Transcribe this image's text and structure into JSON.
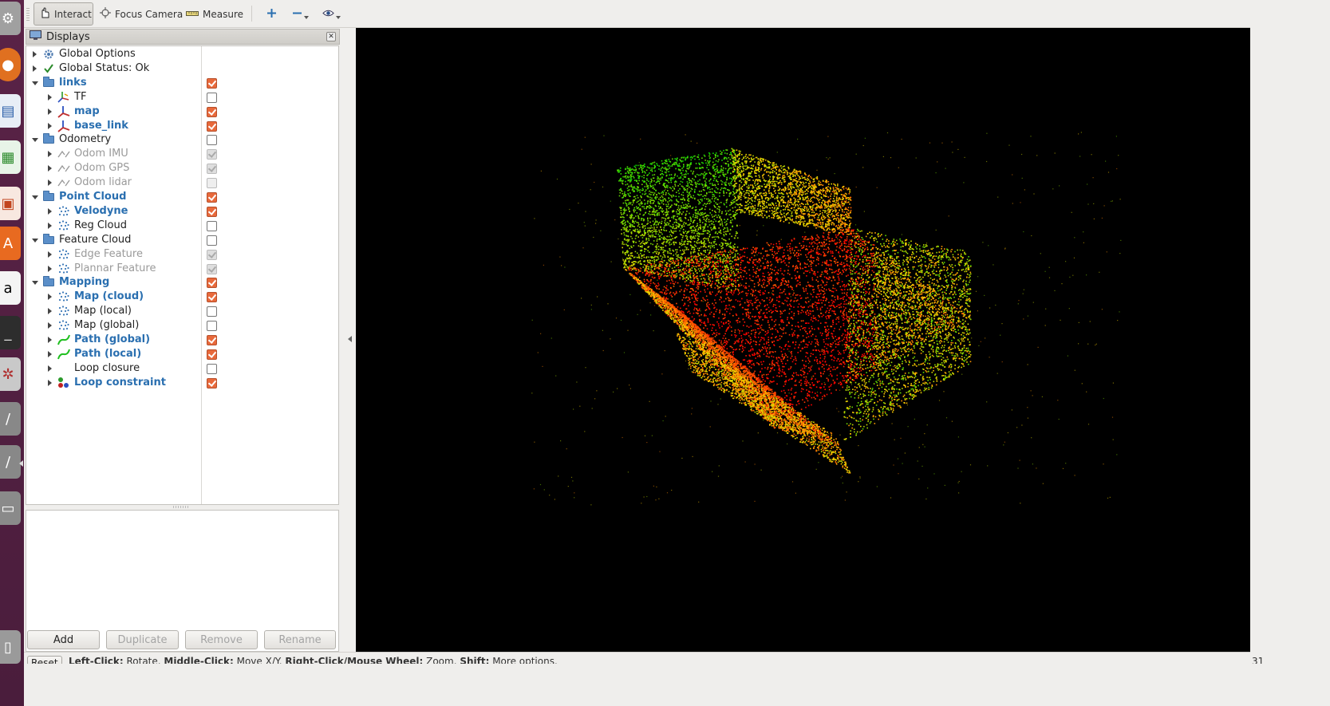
{
  "toolbar": {
    "interact": "Interact",
    "focus_camera": "Focus Camera",
    "measure": "Measure"
  },
  "displays": {
    "title": "Displays",
    "rows": [
      {
        "label": "Global Options",
        "level": 0,
        "expanded": false,
        "icon": "gear-icon",
        "checkbox": null,
        "style": "normal"
      },
      {
        "label": "Global Status: Ok",
        "level": 0,
        "expanded": false,
        "icon": "check-icon",
        "checkbox": null,
        "style": "normal"
      },
      {
        "label": "links",
        "level": 0,
        "expanded": true,
        "icon": "folder-icon",
        "checkbox": true,
        "style": "bold"
      },
      {
        "label": "TF",
        "level": 1,
        "expanded": false,
        "icon": "tf-axes-icon",
        "checkbox": false,
        "style": "normal"
      },
      {
        "label": "map",
        "level": 1,
        "expanded": false,
        "icon": "axes-icon",
        "checkbox": true,
        "style": "bold"
      },
      {
        "label": "base_link",
        "level": 1,
        "expanded": false,
        "icon": "axes-icon",
        "checkbox": true,
        "style": "bold"
      },
      {
        "label": "Odometry",
        "level": 0,
        "expanded": true,
        "icon": "folder-icon",
        "checkbox": false,
        "style": "normal"
      },
      {
        "label": "Odom IMU",
        "level": 1,
        "expanded": false,
        "icon": "odometry-icon",
        "checkbox": true,
        "style": "disabled"
      },
      {
        "label": "Odom GPS",
        "level": 1,
        "expanded": false,
        "icon": "odometry-icon",
        "checkbox": true,
        "style": "disabled"
      },
      {
        "label": "Odom lidar",
        "level": 1,
        "expanded": false,
        "icon": "odometry-icon",
        "checkbox": false,
        "style": "disabled"
      },
      {
        "label": "Point Cloud",
        "level": 0,
        "expanded": true,
        "icon": "folder-icon",
        "checkbox": true,
        "style": "bold"
      },
      {
        "label": "Velodyne",
        "level": 1,
        "expanded": false,
        "icon": "pointcloud-icon",
        "checkbox": true,
        "style": "bold"
      },
      {
        "label": "Reg Cloud",
        "level": 1,
        "expanded": false,
        "icon": "pointcloud-icon",
        "checkbox": false,
        "style": "normal"
      },
      {
        "label": "Feature Cloud",
        "level": 0,
        "expanded": true,
        "icon": "folder-icon",
        "checkbox": false,
        "style": "normal"
      },
      {
        "label": "Edge Feature",
        "level": 1,
        "expanded": false,
        "icon": "pointcloud-icon",
        "checkbox": true,
        "style": "disabled"
      },
      {
        "label": "Plannar Feature",
        "level": 1,
        "expanded": false,
        "icon": "pointcloud-icon",
        "checkbox": true,
        "style": "disabled"
      },
      {
        "label": "Mapping",
        "level": 0,
        "expanded": true,
        "icon": "folder-icon",
        "checkbox": true,
        "style": "bold"
      },
      {
        "label": "Map (cloud)",
        "level": 1,
        "expanded": false,
        "icon": "pointcloud-icon",
        "checkbox": true,
        "style": "bold"
      },
      {
        "label": "Map (local)",
        "level": 1,
        "expanded": false,
        "icon": "pointcloud-icon",
        "checkbox": false,
        "style": "normal"
      },
      {
        "label": "Map (global)",
        "level": 1,
        "expanded": false,
        "icon": "pointcloud-icon",
        "checkbox": false,
        "style": "normal"
      },
      {
        "label": "Path (global)",
        "level": 1,
        "expanded": false,
        "icon": "path-icon",
        "checkbox": true,
        "style": "bold"
      },
      {
        "label": "Path (local)",
        "level": 1,
        "expanded": false,
        "icon": "path-icon",
        "checkbox": true,
        "style": "bold"
      },
      {
        "label": "Loop closure",
        "level": 1,
        "expanded": false,
        "icon": "marker-icon",
        "checkbox": false,
        "style": "normal"
      },
      {
        "label": "Loop constraint",
        "level": 1,
        "expanded": false,
        "icon": "marker-array-icon",
        "checkbox": true,
        "style": "bold"
      }
    ],
    "buttons": {
      "add": "Add",
      "duplicate": "Duplicate",
      "remove": "Remove",
      "rename": "Rename"
    }
  },
  "statusbar": {
    "reset": "Reset",
    "left_click_key": "Left-Click:",
    "left_click_action": " Rotate. ",
    "middle_click_key": "Middle-Click:",
    "middle_click_action": " Move X/Y. ",
    "right_click_key": "Right-Click/Mouse Wheel:",
    "right_click_action": " Zoom. ",
    "shift_key": "Shift:",
    "shift_action": " More options."
  },
  "frame_indicator": "31",
  "colors": {
    "checkbox_on": "#e8693b",
    "bold_label": "#2a6fb0",
    "launcher": "#4a1d3c",
    "view_bg": "#000000"
  }
}
